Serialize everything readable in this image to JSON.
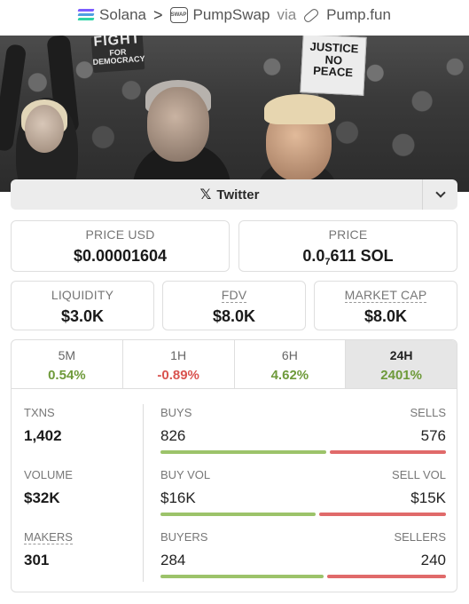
{
  "breadcrumb": {
    "chain": "Solana",
    "separator": ">",
    "dex": "PumpSwap",
    "via": "via",
    "launchpad": "Pump.fun"
  },
  "banner": {
    "sign_left_top": "FOR",
    "sign_left_big": "FIGHT",
    "sign_left_bottom": "DEMOCRACY",
    "sign_right_lines": [
      "JUSTICE",
      "NO",
      "PEACE"
    ]
  },
  "social": {
    "icon": "x-icon",
    "label": "Twitter"
  },
  "price_usd": {
    "label": "PRICE USD",
    "value": "$0.00001604"
  },
  "price_sol": {
    "label": "PRICE",
    "value_prefix": "0.0",
    "value_sub": "7",
    "value_suffix": "611 SOL"
  },
  "liquidity": {
    "label": "LIQUIDITY",
    "value": "$3.0K"
  },
  "fdv": {
    "label": "FDV",
    "value": "$8.0K"
  },
  "market_cap": {
    "label": "MARKET CAP",
    "value": "$8.0K"
  },
  "timeframes": [
    {
      "label": "5M",
      "change": "0.54%",
      "direction": "up"
    },
    {
      "label": "1H",
      "change": "-0.89%",
      "direction": "down"
    },
    {
      "label": "6H",
      "change": "4.62%",
      "direction": "up"
    },
    {
      "label": "24H",
      "change": "2401%",
      "direction": "up",
      "active": true
    }
  ],
  "stats": {
    "txns": {
      "label": "TXNS",
      "value": "1,402",
      "buys_label": "BUYS",
      "buys": "826",
      "sells_label": "SELLS",
      "sells": "576",
      "buy_share": 0.589
    },
    "volume": {
      "label": "VOLUME",
      "value": "$32K",
      "buys_label": "BUY VOL",
      "buys": "$16K",
      "sells_label": "SELL VOL",
      "sells": "$15K",
      "buy_share": 0.55
    },
    "makers": {
      "label": "MAKERS",
      "value": "301",
      "buys_label": "BUYERS",
      "buys": "284",
      "sells_label": "SELLERS",
      "sells": "240",
      "buy_share": 0.58
    }
  },
  "colors": {
    "positive": "#6e9a3a",
    "negative": "#d9534f",
    "buy_bar": "#9cc36a",
    "sell_bar": "#e06a6a"
  }
}
